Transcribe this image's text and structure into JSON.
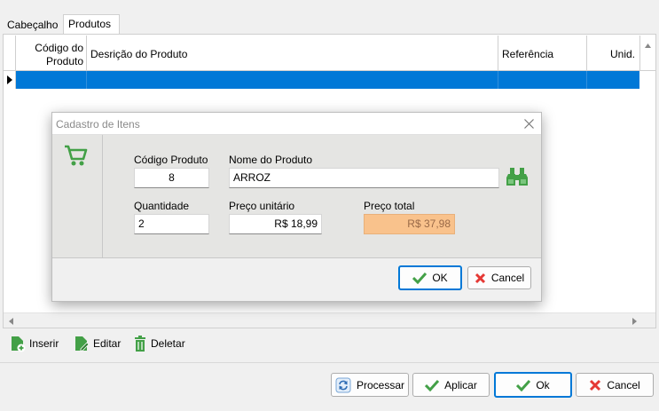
{
  "tabs": [
    {
      "label": "Cabeçalho"
    },
    {
      "label": "Produtos"
    }
  ],
  "grid": {
    "columns": [
      "Código do Produto",
      "Desrição do Produto",
      "Referência",
      "Unid."
    ]
  },
  "toolbar": {
    "insert": "Inserir",
    "edit": "Editar",
    "delete": "Deletar"
  },
  "footer": {
    "process": "Processar",
    "apply": "Aplicar",
    "ok": "Ok",
    "cancel": "Cancel"
  },
  "dialog": {
    "title": "Cadastro de Itens",
    "code_label": "Código Produto",
    "code_value": "8",
    "name_label": "Nome do Produto",
    "name_value": "ARROZ",
    "qty_label": "Quantidade",
    "qty_value": "2",
    "unit_price_label": "Preço unitário",
    "unit_price_value": "R$ 18,99",
    "total_label": "Preço total",
    "total_value": "R$ 37,98",
    "ok": "OK",
    "cancel": "Cancel"
  },
  "colors": {
    "selection": "#0078d7",
    "icon_green": "#4caf50",
    "total_bg": "#f9c28c"
  }
}
